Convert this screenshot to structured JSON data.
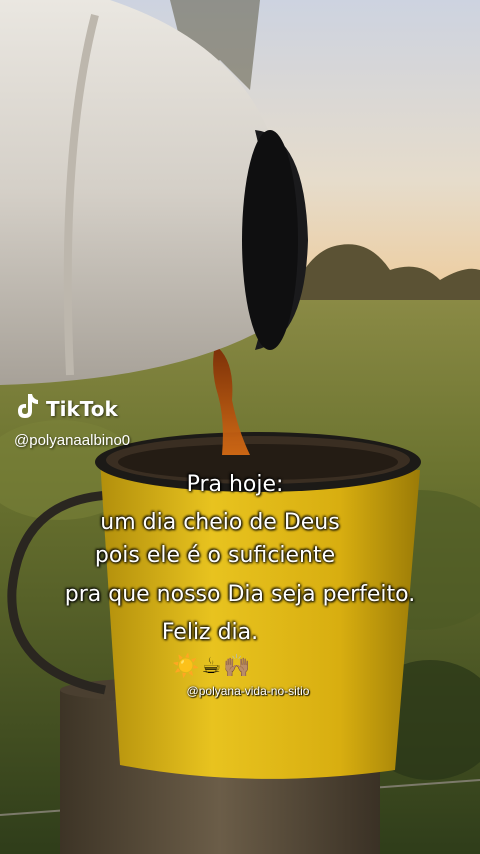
{
  "watermark": {
    "brand": "TikTok",
    "handle": "@polyanaalbino0",
    "icon": "tiktok-note-icon"
  },
  "caption": {
    "line1": "Pra hoje:",
    "line2": "um dia cheio de Deus",
    "line3": "pois ele é o suficiente",
    "line4": "pra que nosso Dia seja perfeito.",
    "line5": "Feliz  dia.",
    "emoji": "☀️☕🙌🏽",
    "sub_handle": "@polyana-vida-no-sitio"
  },
  "colors": {
    "mug_yellow": "#e3b81a",
    "thermos": "#d8d4cc",
    "sky": "#d9dce6",
    "grass": "#5c6e2c"
  }
}
